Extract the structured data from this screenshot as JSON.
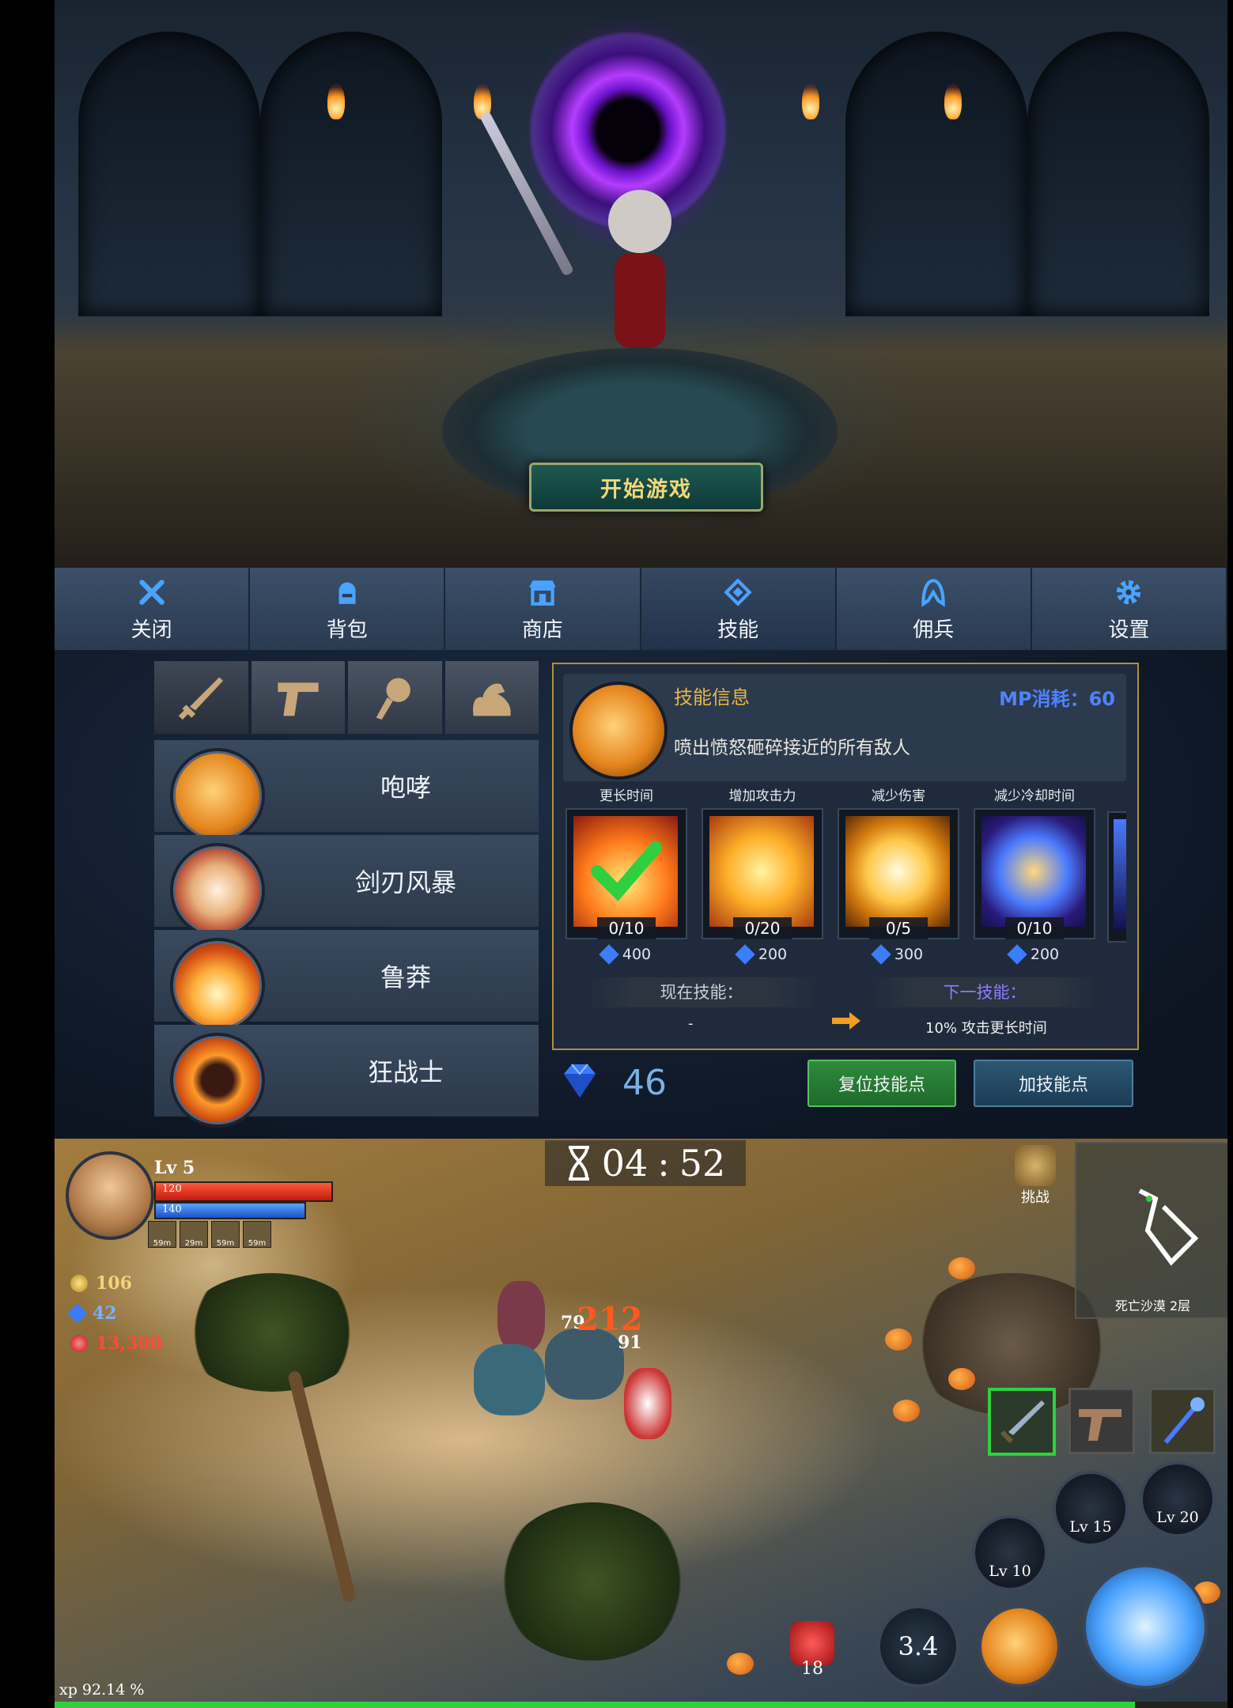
{
  "start_screen": {
    "start_button": "开始游戏"
  },
  "tabs": [
    {
      "label": "关闭",
      "icon": "close-icon"
    },
    {
      "label": "背包",
      "icon": "backpack-icon"
    },
    {
      "label": "商店",
      "icon": "shop-icon"
    },
    {
      "label": "技能",
      "icon": "skill-icon",
      "active": true
    },
    {
      "label": "佣兵",
      "icon": "mercenary-icon"
    },
    {
      "label": "设置",
      "icon": "gear-icon"
    }
  ],
  "skill_categories": [
    "sword-icon",
    "pistol-icon",
    "magic-icon",
    "muscle-icon"
  ],
  "skills": [
    {
      "name": "咆哮"
    },
    {
      "name": "剑刃风暴"
    },
    {
      "name": "鲁莽"
    },
    {
      "name": "狂战士"
    }
  ],
  "skill_info": {
    "title": "技能信息",
    "mp_cost": "MP消耗：60",
    "description": "喷出愤怒砸碎接近的所有敌人",
    "upgrades": [
      {
        "caption": "更长时间",
        "level": "0/10",
        "cost": "400"
      },
      {
        "caption": "增加攻击力",
        "level": "0/20",
        "cost": "200"
      },
      {
        "caption": "减少伤害",
        "level": "0/5",
        "cost": "300"
      },
      {
        "caption": "减少冷却时间",
        "level": "0/10",
        "cost": "200"
      }
    ],
    "current_label": "现在技能：",
    "next_label": "下一技能：",
    "current_value": "-",
    "next_value": "10% 攻击更长时间"
  },
  "gems": "46",
  "buttons": {
    "reset": "复位技能点",
    "add": "加技能点"
  },
  "hud": {
    "level": "Lv 5",
    "hp": "120",
    "mp": "140",
    "buffs": [
      "59m",
      "29m",
      "59m",
      "59m"
    ],
    "gold": "106",
    "diamonds": "42",
    "ruby": "13,300",
    "timer_min": "04",
    "timer_sep": ":",
    "timer_sec": "52",
    "challenge": "挑战",
    "map_name": "死亡沙漠 2层",
    "damage": [
      "79",
      "212",
      "91"
    ],
    "locks": [
      "Lv 15",
      "Lv 20",
      "Lv 10"
    ],
    "cooldown": "3.4",
    "potions": "18",
    "xp": "xp 92.14 %",
    "xp_fraction": 0.9214
  }
}
